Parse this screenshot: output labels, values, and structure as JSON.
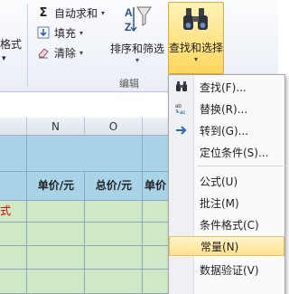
{
  "ribbon": {
    "partial_left_label": "格式",
    "partial_left_arrow": "▾",
    "autosum": {
      "icon": "Σ",
      "label": "自动求和",
      "dropdown": "▾"
    },
    "fill": {
      "label": "填充",
      "dropdown": "▾"
    },
    "clear": {
      "label": "清除",
      "dropdown": "▾"
    },
    "sort_filter": {
      "label": "排序和筛选",
      "dropdown": "▾"
    },
    "find_select": {
      "label": "查找和选择",
      "dropdown": "▾"
    },
    "group_label": "编辑"
  },
  "sheet": {
    "columns": [
      "N",
      "O"
    ],
    "headers": [
      "单价/元",
      "总价/元",
      "单价"
    ],
    "partial_red_text": "式"
  },
  "menu": {
    "items": [
      {
        "label": "查找(F)...",
        "icon": "binoculars-icon"
      },
      {
        "label": "替换(R)...",
        "icon": "replace-icon"
      },
      {
        "label": "转到(G)...",
        "icon": "arrow-right-icon"
      },
      {
        "label": "定位条件(S)...",
        "icon": ""
      },
      {
        "label": "公式(U)",
        "icon": ""
      },
      {
        "label": "批注(M)",
        "icon": ""
      },
      {
        "label": "条件格式(C)",
        "icon": ""
      },
      {
        "label": "常量(N)",
        "icon": ""
      },
      {
        "label": "数据验证(V)",
        "icon": ""
      }
    ]
  },
  "colors": {
    "accent_hover": "#ffe08a",
    "header_blue": "#a9d3e6",
    "cell_green": "#cfe8c5",
    "red_text": "#d20000"
  }
}
